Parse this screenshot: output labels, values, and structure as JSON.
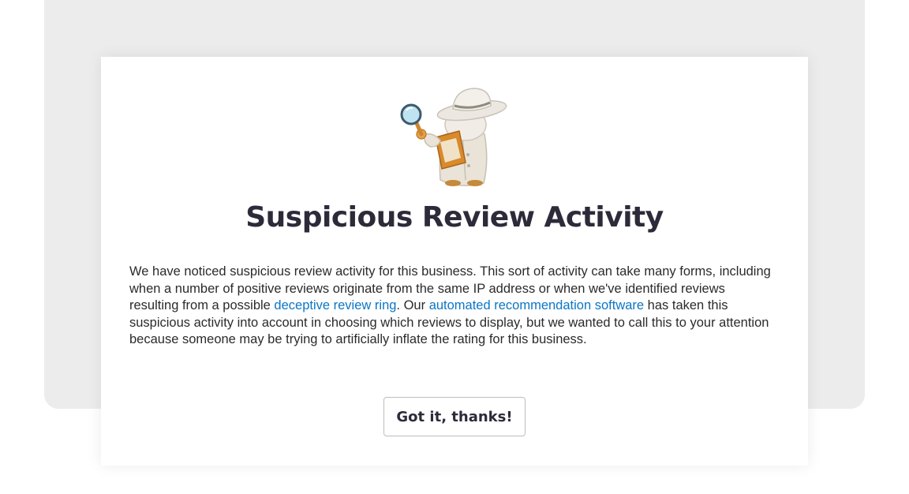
{
  "modal": {
    "title": "Suspicious Review Activity",
    "body": {
      "text_1": "We have noticed suspicious review activity for this business. This sort of activity can take many forms, including when a number of positive reviews originate from the same IP address or when we've identified reviews resulting from a possible ",
      "link_1": "deceptive review ring",
      "text_2": ". Our ",
      "link_2": "automated recommendation software",
      "text_3": " has taken this suspicious activity into account in choosing which reviews to display, but we wanted to call this to your attention because someone may be trying to artificially inflate the rating for this business."
    },
    "button_label": "Got it, thanks!",
    "mascot_icon": "detective-mascot-icon"
  },
  "colors": {
    "link": "#0b76c5",
    "title": "#2d2b3a",
    "backdrop": "#ececec"
  }
}
